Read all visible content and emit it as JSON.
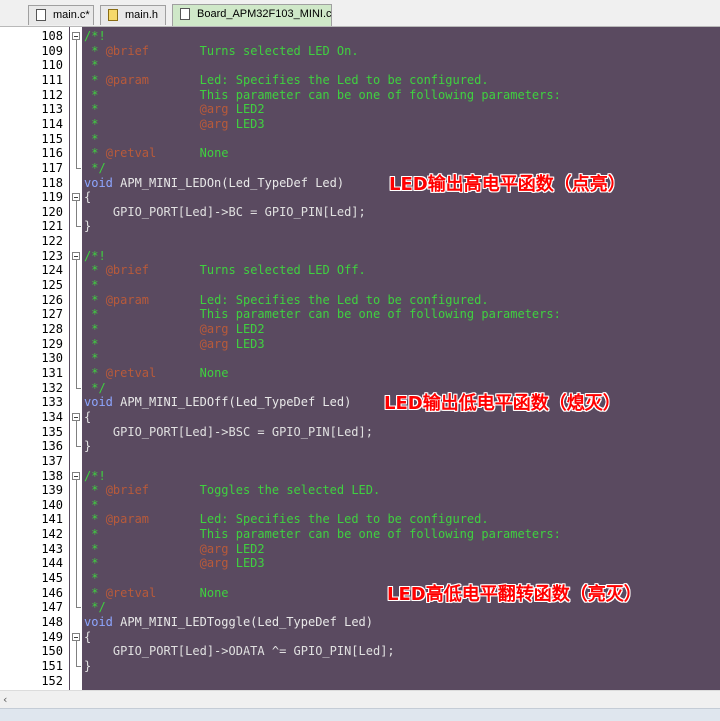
{
  "tabs": [
    {
      "label": "main.c*",
      "icon": "file-icon",
      "active": false
    },
    {
      "label": "main.h",
      "icon": "header-file-icon",
      "active": false
    },
    {
      "label": "Board_APM32F103_MINI.c",
      "icon": "file-icon",
      "active": true
    }
  ],
  "lines": [
    {
      "n": "108",
      "fold": "open",
      "segs": [
        {
          "t": "/*!",
          "c": "c-com"
        }
      ]
    },
    {
      "n": "109",
      "segs": [
        {
          "t": " * ",
          "c": "c-com"
        },
        {
          "t": "@brief",
          "c": "c-tag"
        },
        {
          "t": "       Turns selected LED On.",
          "c": "c-com"
        }
      ]
    },
    {
      "n": "110",
      "segs": [
        {
          "t": " *",
          "c": "c-com"
        }
      ]
    },
    {
      "n": "111",
      "segs": [
        {
          "t": " * ",
          "c": "c-com"
        },
        {
          "t": "@param",
          "c": "c-tag"
        },
        {
          "t": "       Led: Specifies the Led to be configured.",
          "c": "c-com"
        }
      ]
    },
    {
      "n": "112",
      "segs": [
        {
          "t": " *              This parameter can be one of following parameters:",
          "c": "c-com"
        }
      ]
    },
    {
      "n": "113",
      "segs": [
        {
          "t": " *              ",
          "c": "c-com"
        },
        {
          "t": "@arg",
          "c": "c-tag"
        },
        {
          "t": " LED2",
          "c": "c-com"
        }
      ]
    },
    {
      "n": "114",
      "segs": [
        {
          "t": " *              ",
          "c": "c-com"
        },
        {
          "t": "@arg",
          "c": "c-tag"
        },
        {
          "t": " LED3",
          "c": "c-com"
        }
      ]
    },
    {
      "n": "115",
      "segs": [
        {
          "t": " *",
          "c": "c-com"
        }
      ]
    },
    {
      "n": "116",
      "segs": [
        {
          "t": " * ",
          "c": "c-com"
        },
        {
          "t": "@retval",
          "c": "c-tag"
        },
        {
          "t": "      None",
          "c": "c-com"
        }
      ]
    },
    {
      "n": "117",
      "fold": "end",
      "segs": [
        {
          "t": " */",
          "c": "c-com"
        }
      ]
    },
    {
      "n": "118",
      "segs": [
        {
          "t": "void",
          "c": "c-kw"
        },
        {
          "t": " APM_MINI_LEDOn(Led_TypeDef Led)",
          "c": "c-fn"
        }
      ]
    },
    {
      "n": "119",
      "fold": "open",
      "segs": [
        {
          "t": "{",
          "c": "c-op"
        }
      ]
    },
    {
      "n": "120",
      "segs": [
        {
          "t": "    GPIO_PORT[Led]->BC = GPIO_PIN[Led];",
          "c": "c-op"
        }
      ]
    },
    {
      "n": "121",
      "fold": "end",
      "segs": [
        {
          "t": "}",
          "c": "c-op"
        }
      ]
    },
    {
      "n": "122",
      "segs": []
    },
    {
      "n": "123",
      "fold": "open",
      "segs": [
        {
          "t": "/*!",
          "c": "c-com"
        }
      ]
    },
    {
      "n": "124",
      "segs": [
        {
          "t": " * ",
          "c": "c-com"
        },
        {
          "t": "@brief",
          "c": "c-tag"
        },
        {
          "t": "       Turns selected LED Off.",
          "c": "c-com"
        }
      ]
    },
    {
      "n": "125",
      "segs": [
        {
          "t": " *",
          "c": "c-com"
        }
      ]
    },
    {
      "n": "126",
      "segs": [
        {
          "t": " * ",
          "c": "c-com"
        },
        {
          "t": "@param",
          "c": "c-tag"
        },
        {
          "t": "       Led: Specifies the Led to be configured.",
          "c": "c-com"
        }
      ]
    },
    {
      "n": "127",
      "segs": [
        {
          "t": " *              This parameter can be one of following parameters:",
          "c": "c-com"
        }
      ]
    },
    {
      "n": "128",
      "segs": [
        {
          "t": " *              ",
          "c": "c-com"
        },
        {
          "t": "@arg",
          "c": "c-tag"
        },
        {
          "t": " LED2",
          "c": "c-com"
        }
      ]
    },
    {
      "n": "129",
      "segs": [
        {
          "t": " *              ",
          "c": "c-com"
        },
        {
          "t": "@arg",
          "c": "c-tag"
        },
        {
          "t": " LED3",
          "c": "c-com"
        }
      ]
    },
    {
      "n": "130",
      "segs": [
        {
          "t": " *",
          "c": "c-com"
        }
      ]
    },
    {
      "n": "131",
      "segs": [
        {
          "t": " * ",
          "c": "c-com"
        },
        {
          "t": "@retval",
          "c": "c-tag"
        },
        {
          "t": "      None",
          "c": "c-com"
        }
      ]
    },
    {
      "n": "132",
      "fold": "end",
      "segs": [
        {
          "t": " */",
          "c": "c-com"
        }
      ]
    },
    {
      "n": "133",
      "segs": [
        {
          "t": "void",
          "c": "c-kw"
        },
        {
          "t": " APM_MINI_LEDOff(Led_TypeDef Led)",
          "c": "c-fn"
        }
      ]
    },
    {
      "n": "134",
      "fold": "open",
      "segs": [
        {
          "t": "{",
          "c": "c-op"
        }
      ]
    },
    {
      "n": "135",
      "segs": [
        {
          "t": "    GPIO_PORT[Led]->BSC = GPIO_PIN[Led];",
          "c": "c-op"
        }
      ]
    },
    {
      "n": "136",
      "fold": "end",
      "segs": [
        {
          "t": "}",
          "c": "c-op"
        }
      ]
    },
    {
      "n": "137",
      "segs": []
    },
    {
      "n": "138",
      "fold": "open",
      "segs": [
        {
          "t": "/*!",
          "c": "c-com"
        }
      ]
    },
    {
      "n": "139",
      "segs": [
        {
          "t": " * ",
          "c": "c-com"
        },
        {
          "t": "@brief",
          "c": "c-tag"
        },
        {
          "t": "       Toggles the selected LED.",
          "c": "c-com"
        }
      ]
    },
    {
      "n": "140",
      "segs": [
        {
          "t": " *",
          "c": "c-com"
        }
      ]
    },
    {
      "n": "141",
      "segs": [
        {
          "t": " * ",
          "c": "c-com"
        },
        {
          "t": "@param",
          "c": "c-tag"
        },
        {
          "t": "       Led: Specifies the Led to be configured.",
          "c": "c-com"
        }
      ]
    },
    {
      "n": "142",
      "segs": [
        {
          "t": " *              This parameter can be one of following parameters:",
          "c": "c-com"
        }
      ]
    },
    {
      "n": "143",
      "segs": [
        {
          "t": " *              ",
          "c": "c-com"
        },
        {
          "t": "@arg",
          "c": "c-tag"
        },
        {
          "t": " LED2",
          "c": "c-com"
        }
      ]
    },
    {
      "n": "144",
      "segs": [
        {
          "t": " *              ",
          "c": "c-com"
        },
        {
          "t": "@arg",
          "c": "c-tag"
        },
        {
          "t": " LED3",
          "c": "c-com"
        }
      ]
    },
    {
      "n": "145",
      "segs": [
        {
          "t": " *",
          "c": "c-com"
        }
      ]
    },
    {
      "n": "146",
      "segs": [
        {
          "t": " * ",
          "c": "c-com"
        },
        {
          "t": "@retval",
          "c": "c-tag"
        },
        {
          "t": "      None",
          "c": "c-com"
        }
      ]
    },
    {
      "n": "147",
      "fold": "end",
      "segs": [
        {
          "t": " */",
          "c": "c-com"
        }
      ]
    },
    {
      "n": "148",
      "segs": [
        {
          "t": "void",
          "c": "c-kw"
        },
        {
          "t": " APM_MINI_LEDToggle(Led_TypeDef Led)",
          "c": "c-fn"
        }
      ]
    },
    {
      "n": "149",
      "fold": "open",
      "segs": [
        {
          "t": "{",
          "c": "c-op"
        }
      ]
    },
    {
      "n": "150",
      "segs": [
        {
          "t": "    GPIO_PORT[Led]->ODATA ^= GPIO_PIN[Led];",
          "c": "c-op"
        }
      ]
    },
    {
      "n": "151",
      "fold": "end",
      "segs": [
        {
          "t": "}",
          "c": "c-op"
        }
      ]
    },
    {
      "n": "152",
      "segs": []
    }
  ],
  "annotations": [
    {
      "text": "LED输出高电平函数（点亮）",
      "line": 10
    },
    {
      "text": "LED输出低电平函数（熄灭）",
      "line": 25
    },
    {
      "text": "LED高低电平翻转函数（亮灭）",
      "line": 38
    }
  ],
  "colors": {
    "editor_bg": "#5a4a60",
    "comment": "#3fd13f",
    "doc_tag": "#b85a3a",
    "keyword": "#8ea6ff",
    "annotation": "#ff0000"
  },
  "scroll_left_arrow": "‹"
}
